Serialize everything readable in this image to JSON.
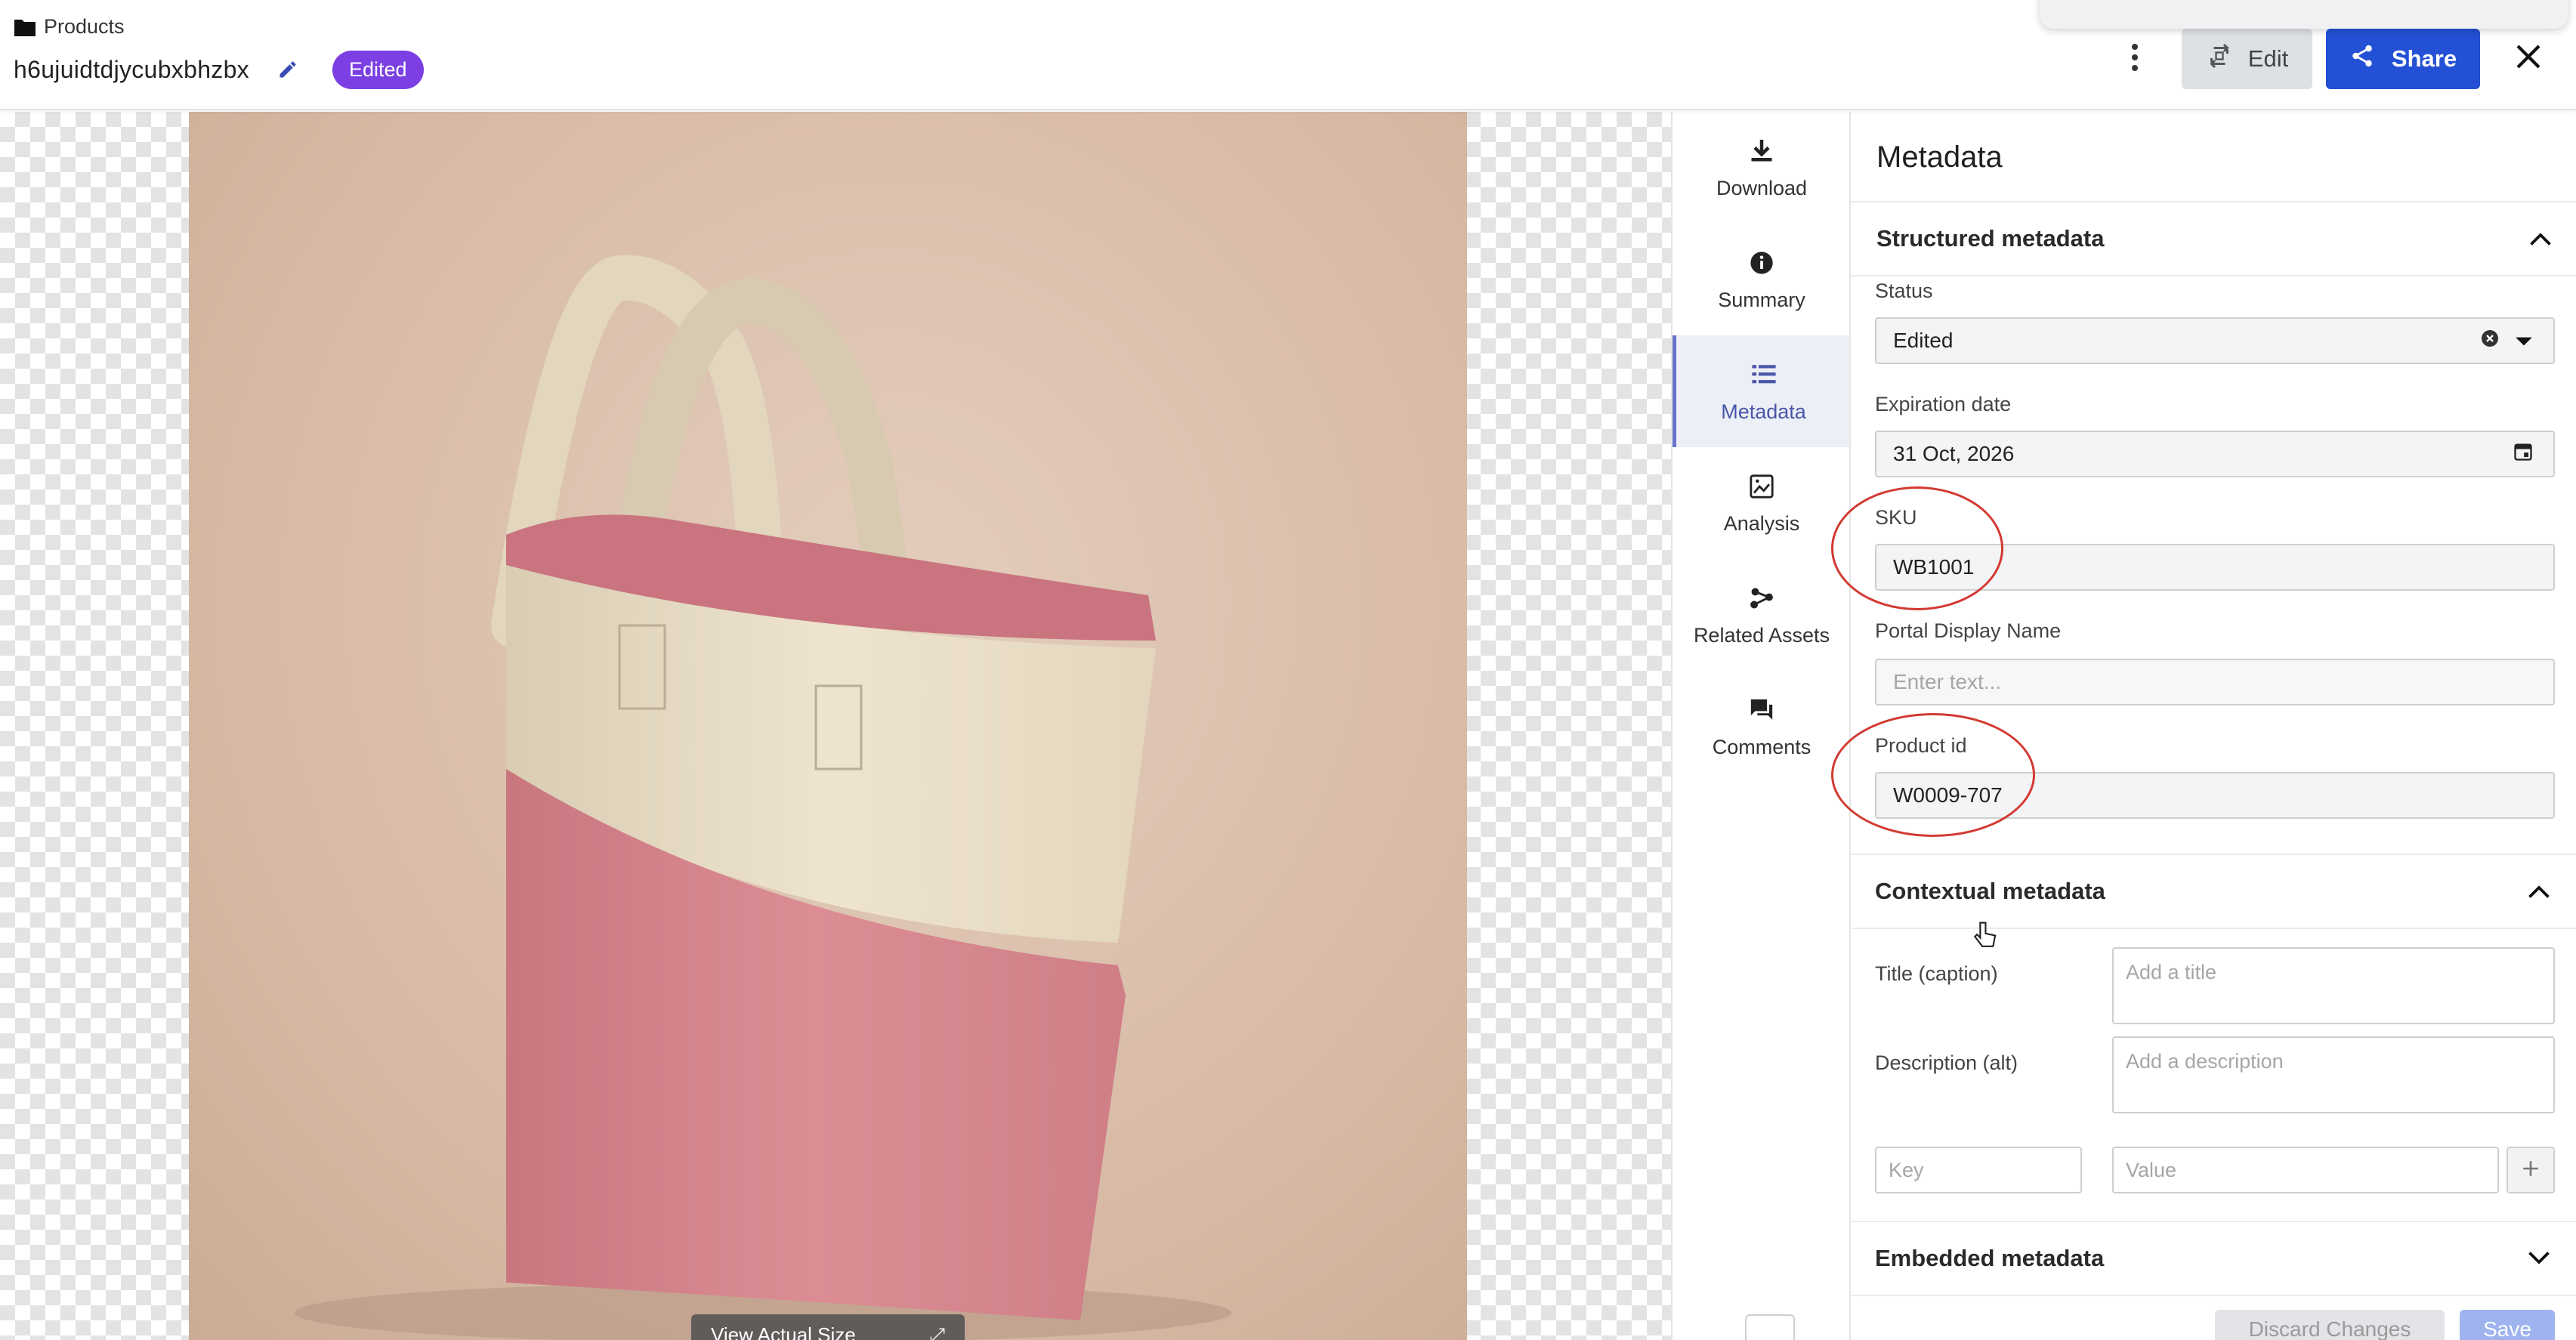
{
  "header": {
    "breadcrumb": "Products",
    "asset_name": "h6ujuidtdjycubxbhzbx",
    "status_pill": "Edited",
    "edit_label": "Edit",
    "share_label": "Share"
  },
  "viewer": {
    "view_actual_label": "View Actual Size"
  },
  "sidenav": {
    "items": [
      {
        "label": "Download",
        "icon": "download-icon"
      },
      {
        "label": "Summary",
        "icon": "info-icon"
      },
      {
        "label": "Metadata",
        "icon": "list-icon",
        "active": true
      },
      {
        "label": "Analysis",
        "icon": "analysis-icon"
      },
      {
        "label": "Related Assets",
        "icon": "related-icon"
      },
      {
        "label": "Comments",
        "icon": "comments-icon"
      }
    ]
  },
  "metadata": {
    "title": "Metadata",
    "structured": {
      "heading": "Structured metadata",
      "status_label": "Status",
      "status_value": "Edited",
      "expiration_label": "Expiration date",
      "expiration_value": "31 Oct, 2026",
      "sku_label": "SKU",
      "sku_value": "WB1001",
      "portal_label": "Portal Display Name",
      "portal_placeholder": "Enter text...",
      "product_id_label": "Product id",
      "product_id_value": "W0009-707"
    },
    "contextual": {
      "heading": "Contextual metadata",
      "title_label": "Title (caption)",
      "title_placeholder": "Add a title",
      "description_label": "Description (alt)",
      "description_placeholder": "Add a description",
      "key_placeholder": "Key",
      "value_placeholder": "Value"
    },
    "embedded": {
      "heading": "Embedded metadata"
    },
    "footer": {
      "discard_label": "Discard Changes",
      "save_label": "Save"
    }
  },
  "colors": {
    "accent_blue": "#2350d4",
    "status_purple": "#7b3fe4",
    "annotation_red": "#d23a32"
  }
}
